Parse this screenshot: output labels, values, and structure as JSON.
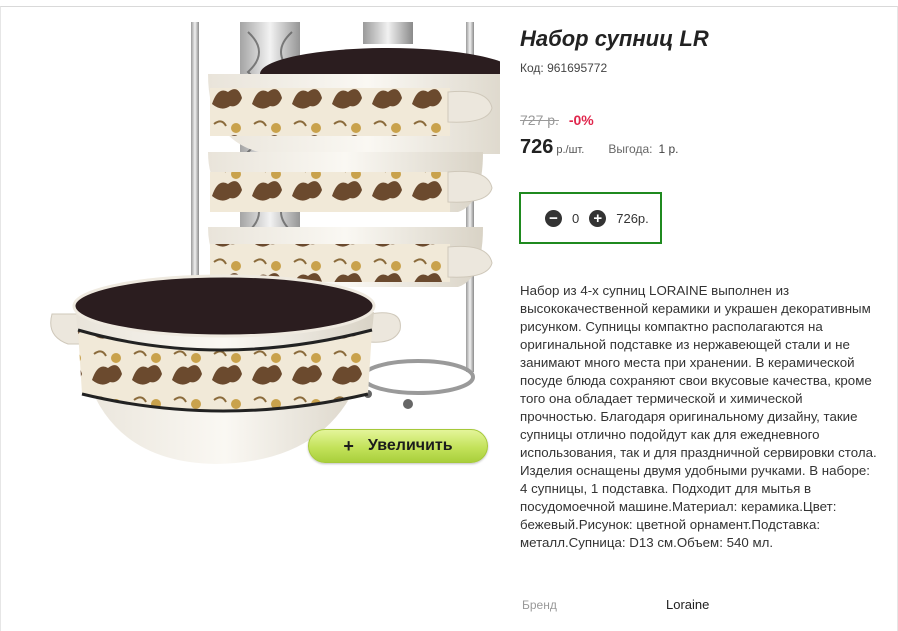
{
  "product": {
    "title": "Набор супниц LR",
    "code": "Код: 961695772",
    "old_price": "727 р.",
    "discount": "-0%",
    "price": "726",
    "unit": "р./шт.",
    "benefit_label": "Выгода:",
    "benefit_value": "1 р.",
    "description": "Набор из 4-х супниц LORAINE выполнен из высококачественной керамики и украшен декоративным рисунком. Супницы компактно располагаются на оригинальной подставке из нержавеющей стали и не занимают много места при хранении. В керамической посуде блюда сохраняют свои вкусовые качества, кроме того она обладает термической и химической прочностью. Благодаря оригинальному дизайну, такие супницы отлично подойдут как для ежедневного использования, так и для праздничной сервировки стола. Изделия оснащены двумя удобными ручками. В наборе: 4 супницы, 1 подставка. Подходит для мытья в посудомоечной машине.Материал: керамика.Цвет: бежевый.Рисунок: цветной орнамент.Подставка: металл.Супница: D13 см.Объем: 540 мл."
  },
  "cart": {
    "quantity": "0",
    "total": "726р.",
    "minus_symbol": "−",
    "plus_symbol": "+"
  },
  "zoom": {
    "plus": "+",
    "label": "Увеличить"
  },
  "brand": {
    "label": "Бренд",
    "value": "Loraine"
  },
  "colors": {
    "accent_green_border": "#1f8a1f",
    "discount_red": "#e0264c",
    "zoom_button_green": "#c3e25a"
  },
  "icons": [
    "minus-circle-icon",
    "plus-circle-icon"
  ]
}
